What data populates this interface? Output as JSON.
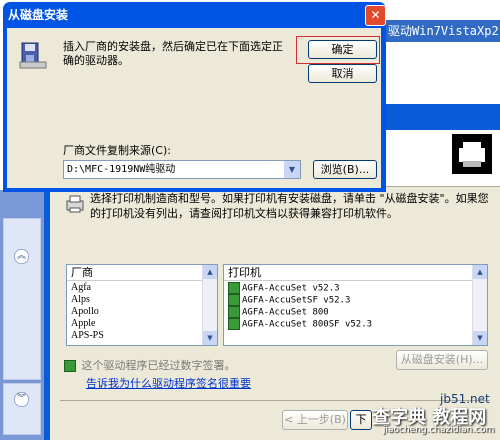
{
  "background": {
    "title_fragment": "驱动Win7VistaXp2",
    "wizard": {
      "description": "选择打印机制造商和型号。如果打印机有安装磁盘，请单击 \"从磁盘安装\"。如果您的打印机没有列出，请查阅打印机文档以获得兼容打印机软件。",
      "manufacturer_header": "厂商",
      "manufacturers": [
        "Agfa",
        "Alps",
        "Apollo",
        "Apple",
        "APS-PS"
      ],
      "model_header": "打印机",
      "models": [
        "AGFA-AccuSet v52.3",
        "AGFA-AccuSetSF v52.3",
        "AGFA-AccuSet 800",
        "AGFA-AccuSet 800SF v52.3"
      ],
      "signed_text": "这个驱动程序已经过数字签署。",
      "signed_link": "告诉我为什么驱动程序签名很重要",
      "from_disk_label": "从磁盘安装(H)...",
      "back_label": "< 上一步(B)",
      "next_label": "下"
    },
    "watermarks": [
      "查字典 教程网",
      "jiaocheng.chazidian.com",
      "jb51.net"
    ]
  },
  "dialog": {
    "title": "从磁盘安装",
    "message": "插入厂商的安装盘，然后确定已在下面选定正确的驱动器。",
    "ok_label": "确定",
    "cancel_label": "取消",
    "copy_from_label": "厂商文件复制来源(C):",
    "path_value": "D:\\MFC-1919NW纯驱动",
    "browse_label": "浏览(B)...",
    "close_glyph": "✕"
  },
  "icons": {
    "chevron_up": "︽",
    "chevron_down": "︾",
    "scroll_up": "▲",
    "scroll_down": "▼",
    "dropdown": "▼"
  },
  "colors": {
    "title_bar": "#0054e3",
    "dialog_face": "#ece9d8",
    "highlight": "#d03030"
  }
}
